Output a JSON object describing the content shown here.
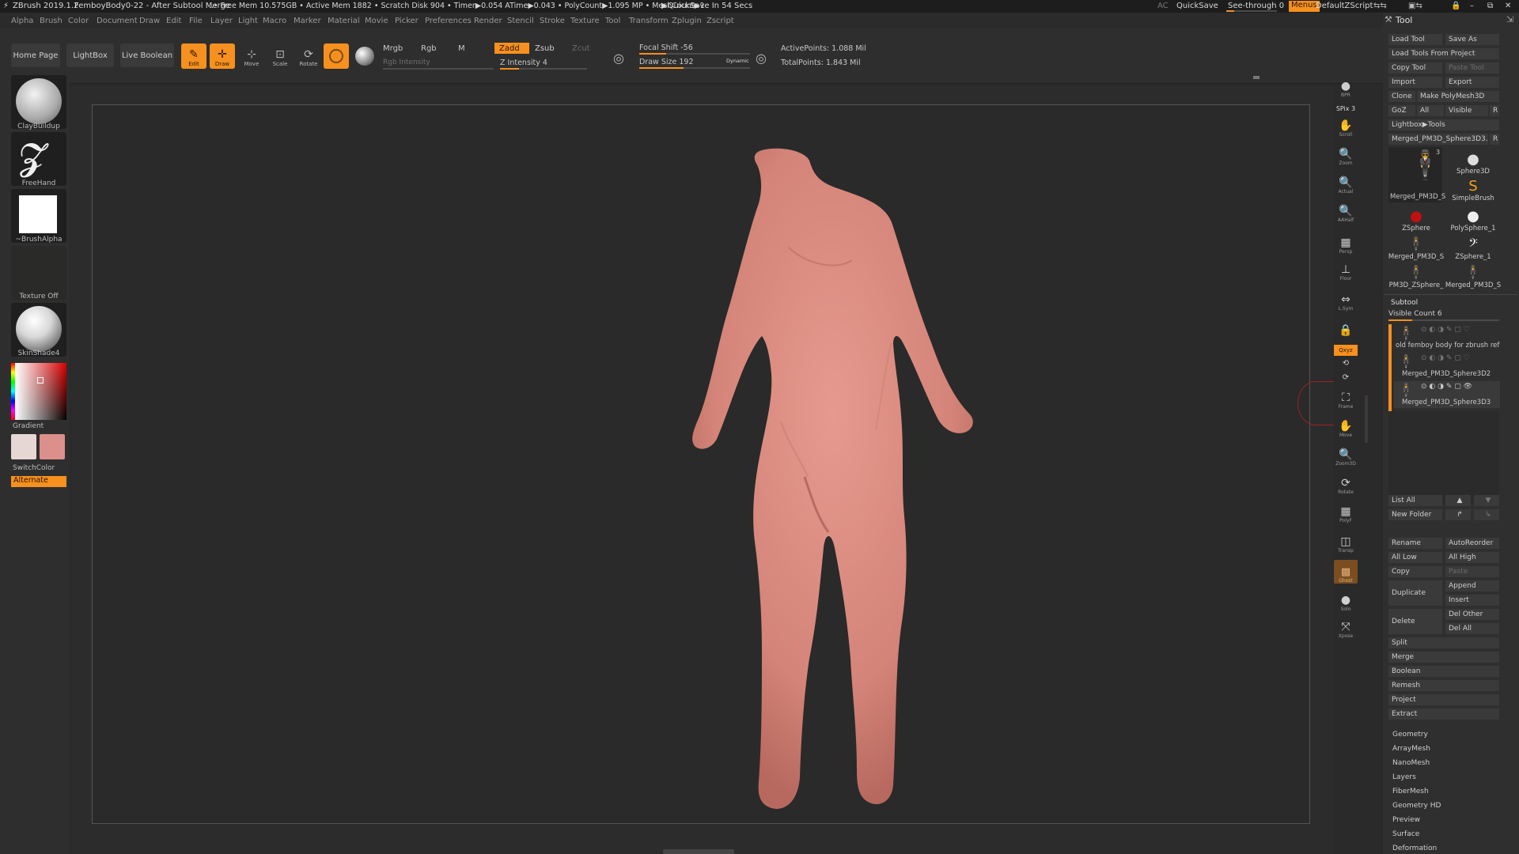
{
  "titlebar": {
    "app": "ZBrush 2019.1.2",
    "doc": "FemboyBody0-22 - After Subtool Merge",
    "stats": "..• Free Mem 10.575GB • Active Mem 1882 • Scratch Disk 904 • Timer▶0.054 ATime▶0.043 • PolyCount▶1.095 MP • MeshCount▶1",
    "quicksave_timer": "▶QuickSave In 54 Secs",
    "ac": "AC",
    "quicksave": "QuickSave",
    "seethrough": "See-through",
    "seethrough_value": "0",
    "menus": "Menus",
    "script": "DefaultZScript"
  },
  "menubar": [
    "Alpha",
    "Brush",
    "Color",
    "Document",
    "Draw",
    "Edit",
    "File",
    "Layer",
    "Light",
    "Macro",
    "Marker",
    "Material",
    "Movie",
    "Picker",
    "Preferences",
    "Render",
    "Stencil",
    "Stroke",
    "Texture",
    "Tool",
    "Transform",
    "Zplugin",
    "Zscript"
  ],
  "shelf": {
    "home": "Home Page",
    "lightbox": "LightBox",
    "liveboolean": "Live Boolean",
    "edit": "Edit",
    "draw": "Draw",
    "move": "Move",
    "scale": "Scale",
    "rotate": "Rotate",
    "mrgb": "Mrgb",
    "rgb": "Rgb",
    "m": "M",
    "rgb_intensity": "Rgb Intensity",
    "zadd": "Zadd",
    "zsub": "Zsub",
    "zcut": "Zcut",
    "z_intensity": "Z Intensity 4",
    "focal_shift": "Focal Shift -56",
    "draw_size": "Draw Size 192",
    "dynamic": "Dynamic",
    "active_points": "ActivePoints: 1.088 Mil",
    "total_points": "TotalPoints: 1.843 Mil"
  },
  "left": {
    "brush": "ClayBuildup",
    "stroke": "FreeHand",
    "alpha": "~BrushAlpha",
    "texture": "Texture Off",
    "material": "SkinShade4",
    "gradient": "Gradient",
    "switchcolor": "SwitchColor",
    "alternate": "Alternate"
  },
  "viewstrip": [
    "BPR",
    "SPix 3",
    "Scroll",
    "Zoom",
    "Actual",
    "AAHalf",
    "Persp",
    "Floor",
    "L.Sym",
    "",
    "Qxyz",
    "",
    "",
    "Frame",
    "Move",
    "Zoom3D",
    "Rotate",
    "PolyF",
    "Transp",
    "Ghost",
    "Solo",
    "Xpose"
  ],
  "tool": {
    "title": "Tool",
    "load_tool": "Load Tool",
    "save_as": "Save As",
    "load_from_project": "Load Tools From Project",
    "copy_tool": "Copy Tool",
    "paste_tool": "Paste Tool",
    "import": "Import",
    "export": "Export",
    "clone": "Clone",
    "make_polymesh": "Make PolyMesh3D",
    "goz": "GoZ",
    "all": "All",
    "visible": "Visible",
    "r": "R",
    "lightbox_tools": "Lightbox▶Tools",
    "current_tool": "Merged_PM3D_Sphere3D3.",
    "current_r": "R",
    "tools": [
      {
        "name": "Merged_PM3D_S",
        "badge": "3"
      },
      {
        "name": "Sphere3D",
        "badge": ""
      },
      {
        "name": "SimpleBrush",
        "badge": ""
      },
      {
        "name": "ZSphere",
        "badge": ""
      },
      {
        "name": "PolySphere_1",
        "badge": ""
      },
      {
        "name": "Merged_PM3D_S",
        "badge": ""
      },
      {
        "name": "ZSphere_1",
        "badge": ""
      },
      {
        "name": "PM3D_ZSphere_",
        "badge": ""
      },
      {
        "name": "Merged_PM3D_S",
        "badge": "3"
      }
    ],
    "subtool": {
      "title": "Subtool",
      "visible_count": "Visible Count 6",
      "items": [
        "old femboy body for zbrush ref",
        "Merged_PM3D_Sphere3D2",
        "Merged_PM3D_Sphere3D3"
      ],
      "list_all": "List All",
      "new_folder": "New Folder",
      "rename": "Rename",
      "autoreorder": "AutoReorder",
      "all_low": "All Low",
      "all_high": "All High",
      "copy": "Copy",
      "paste": "Paste",
      "duplicate": "Duplicate",
      "append": "Append",
      "insert": "Insert",
      "delete": "Delete",
      "del_other": "Del Other",
      "del_all": "Del All",
      "split": "Split",
      "merge": "Merge",
      "boolean": "Boolean",
      "remesh": "Remesh",
      "project": "Project",
      "extract": "Extract"
    },
    "sections": [
      "Geometry",
      "ArrayMesh",
      "NanoMesh",
      "Layers",
      "FiberMesh",
      "Geometry HD",
      "Preview",
      "Surface",
      "Deformation"
    ]
  },
  "colors": {
    "accent": "#f6901e",
    "skin": "#d98a80",
    "primary_color": "#e6d6d4",
    "secondary_color": "#dc908b"
  }
}
